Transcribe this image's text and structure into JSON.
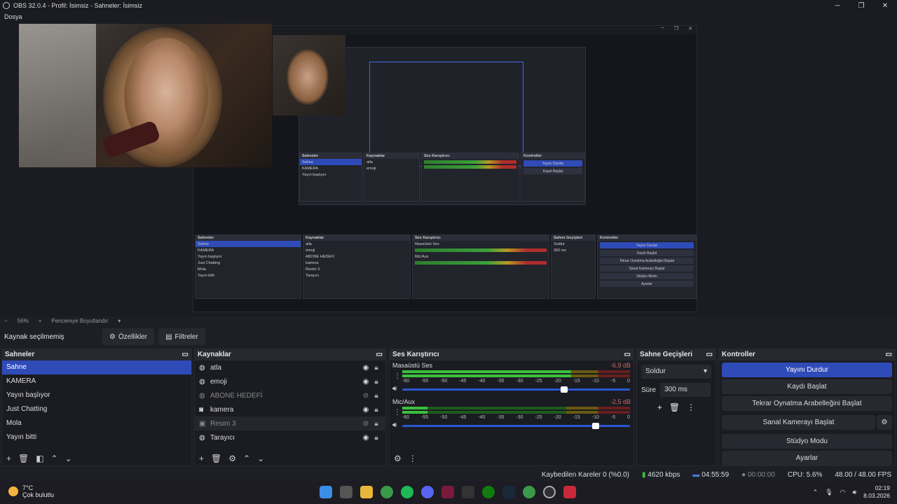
{
  "window": {
    "title": "OBS 32.0.4 - Profil: İsimsiz - Sahneler: İsimsiz",
    "menu_first": "Dosya"
  },
  "zoom": {
    "value": "56%",
    "fit_label": "Pencereye Boyutlandır"
  },
  "toolbar": {
    "no_source": "Kaynak seçilmemiş",
    "properties": "Özellikler",
    "filters": "Filtreler"
  },
  "scenes": {
    "title": "Sahneler",
    "items": [
      "Sahne",
      "KAMERA",
      "Yayın başlıyor",
      "Just Chatting",
      "Mola",
      "Yayın bitti"
    ],
    "selected": 0
  },
  "sources": {
    "title": "Kaynaklar",
    "items": [
      {
        "name": "atla",
        "icon": "globe-icon"
      },
      {
        "name": "emoji",
        "icon": "globe-icon"
      },
      {
        "name": "ABONE HEDEFİ",
        "icon": "globe-icon"
      },
      {
        "name": "kamera",
        "icon": "camera-icon"
      },
      {
        "name": "Resim 3",
        "icon": "image-icon"
      },
      {
        "name": "Tarayıcı",
        "icon": "globe-icon"
      }
    ]
  },
  "mixer": {
    "title": "Ses Karıştırıcı",
    "channels": [
      {
        "name": "Masaüstü Ses",
        "db": "-6,9 dB",
        "level": 0.74,
        "volume": 0.71
      },
      {
        "name": "Mic/Aux",
        "db": "-2,5 dB",
        "level": 0.11,
        "volume": 0.85
      }
    ],
    "ticks": [
      "-60",
      "-55",
      "-50",
      "-45",
      "-40",
      "-35",
      "-30",
      "-25",
      "-20",
      "-15",
      "-10",
      "-5",
      "0"
    ]
  },
  "transitions": {
    "title": "Sahne Geçişleri",
    "selected": "Soldur",
    "duration_label": "Süre",
    "duration": "300 ms"
  },
  "controls": {
    "title": "Kontroller",
    "buttons": [
      "Yayını Durdur",
      "Kaydı Başlat",
      "Tekrar Oynatma Arabelleğini Başlat",
      "Sanal Kamerayı Başlat",
      "Stüdyo Modu",
      "Ayarlar"
    ]
  },
  "status": {
    "dropped": "Kaybedilen Kareler 0 (%0.0)",
    "bitrate": "4620 kbps",
    "stream_time": "04:55:59",
    "rec_time": "00:00:00",
    "cpu": "CPU: 5.6%",
    "fps": "48.00 / 48.00 FPS"
  },
  "taskbar": {
    "temp": "7°C",
    "weather": "Çok bulutlu",
    "time": "02:19",
    "date": "8.03.2026"
  },
  "mini_panels": {
    "scenes": "Sahneler",
    "sources": "Kaynaklar",
    "mixer": "Ses Karıştırıcı",
    "transitions": "Sahne Geçişleri",
    "controls": "Kontroller"
  },
  "colors": {
    "accent": "#2f4bb8",
    "bg": "#1d1f26"
  }
}
